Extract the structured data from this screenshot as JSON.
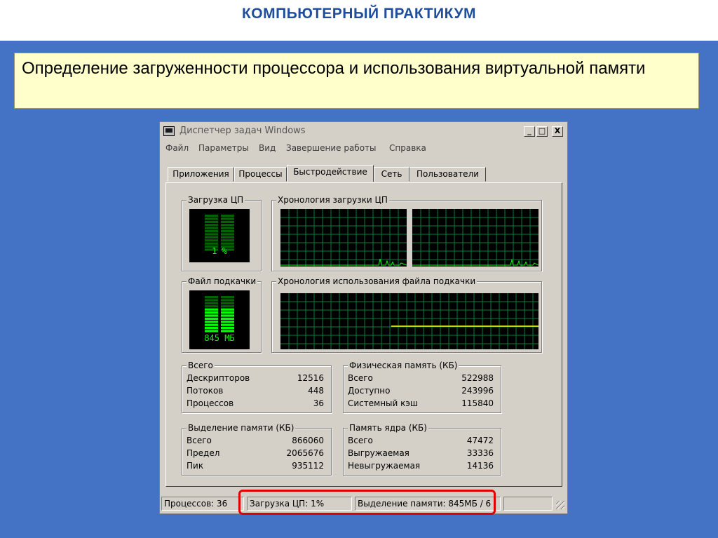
{
  "slide": {
    "title": "КОМПЬЮТЕРНЫЙ ПРАКТИКУМ",
    "heading": "Определение загруженности процессора и использования виртуальной памяти"
  },
  "window": {
    "title": "Диспетчер задач Windows",
    "controls": {
      "minimize": "_",
      "maximize": "□",
      "close": "X"
    },
    "menu": [
      "Файл",
      "Параметры",
      "Вид",
      "Завершение работы",
      "Справка"
    ],
    "tabs": [
      "Приложения",
      "Процессы",
      "Быстродействие",
      "Сеть",
      "Пользователи"
    ],
    "active_tab": "Быстродействие"
  },
  "cpu_usage": {
    "label": "Загрузка ЦП",
    "value_text": "1 %",
    "percent": 1
  },
  "cpu_history": {
    "label": "Хронология загрузки ЦП",
    "cores": 2
  },
  "pagefile": {
    "label": "Файл подкачки",
    "value_text": "845 МБ"
  },
  "pagefile_history": {
    "label": "Хронология использования файла подкачки"
  },
  "totals": {
    "label": "Всего",
    "rows": [
      {
        "k": "Дескрипторов",
        "v": "12516"
      },
      {
        "k": "Потоков",
        "v": "448"
      },
      {
        "k": "Процессов",
        "v": "36"
      }
    ]
  },
  "physical_memory": {
    "label": "Физическая память (КБ)",
    "rows": [
      {
        "k": "Всего",
        "v": "522988"
      },
      {
        "k": "Доступно",
        "v": "243996"
      },
      {
        "k": "Системный кэш",
        "v": "115840"
      }
    ]
  },
  "commit_charge": {
    "label": "Выделение памяти (КБ)",
    "rows": [
      {
        "k": "Всего",
        "v": "866060"
      },
      {
        "k": "Предел",
        "v": "2065676"
      },
      {
        "k": "Пик",
        "v": "935112"
      }
    ]
  },
  "kernel_memory": {
    "label": "Память ядра (КБ)",
    "rows": [
      {
        "k": "Всего",
        "v": "47472"
      },
      {
        "k": "Выгружаемая",
        "v": "33336"
      },
      {
        "k": "Невыгружаемая",
        "v": "14136"
      }
    ]
  },
  "statusbar": {
    "processes": "Процессов: 36",
    "cpu": "Загрузка ЦП: 1%",
    "commit": "Выделение памяти: 845МБ / 6"
  },
  "colors": {
    "slide_bg": "#4472c4",
    "title": "#1f4e9a",
    "note_bg": "#ffffcc",
    "graph_grid": "#008040",
    "graph_line": "#00ff00",
    "pagefile_line": "#ffff00",
    "highlight": "#e00000"
  }
}
